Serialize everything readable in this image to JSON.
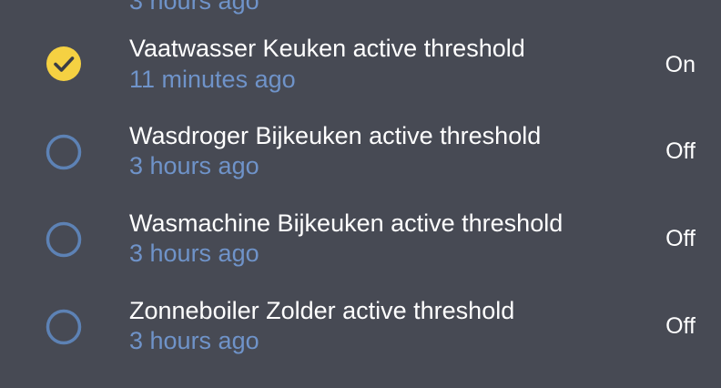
{
  "header": {
    "clipped_text": "3 hours ago"
  },
  "items": [
    {
      "title": "Vaatwasser Keuken active threshold",
      "subtitle": "11 minutes ago",
      "state": "On",
      "icon": "check-circle-icon",
      "icon_color": "#f5d142"
    },
    {
      "title": "Wasdroger Bijkeuken active threshold",
      "subtitle": "3 hours ago",
      "state": "Off",
      "icon": "circle-outline-icon",
      "icon_color": "#5d82b5"
    },
    {
      "title": "Wasmachine Bijkeuken active threshold",
      "subtitle": "3 hours ago",
      "state": "Off",
      "icon": "circle-outline-icon",
      "icon_color": "#5d82b5"
    },
    {
      "title": "Zonneboiler Zolder active threshold",
      "subtitle": "3 hours ago",
      "state": "Off",
      "icon": "circle-outline-icon",
      "icon_color": "#5d82b5"
    }
  ],
  "colors": {
    "background": "#474a54",
    "text_primary": "#ffffff",
    "text_secondary": "#6f93c9"
  }
}
